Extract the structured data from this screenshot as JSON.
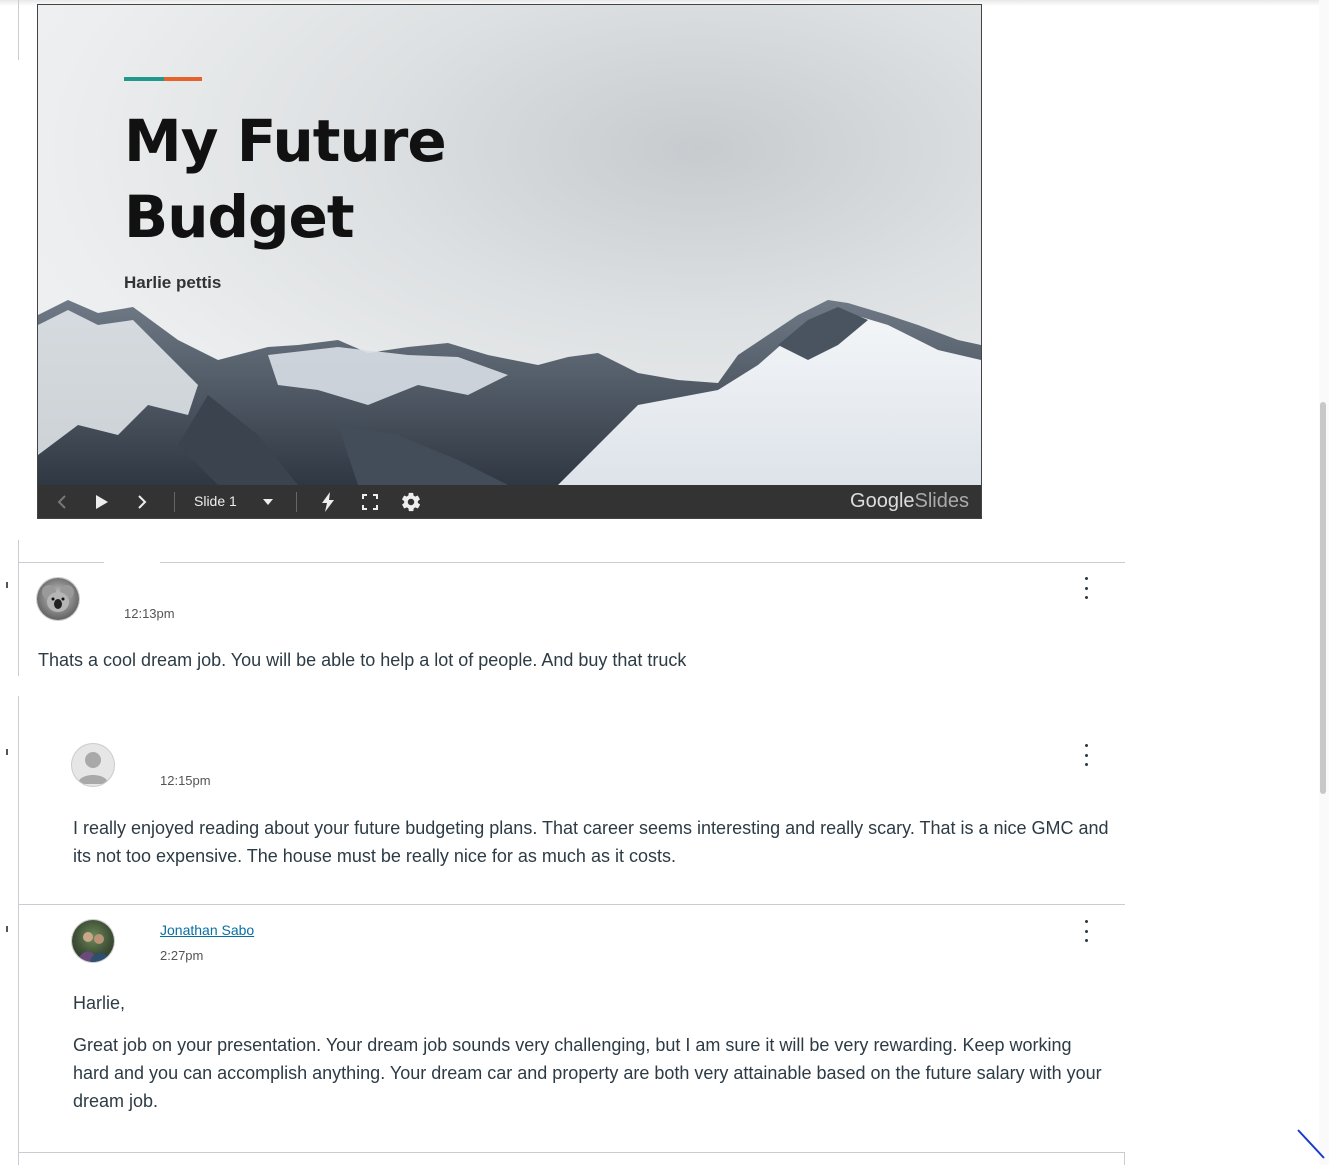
{
  "slide": {
    "title": "My Future\nBudget",
    "author": "Harlie pettis",
    "slide_indicator": "Slide 1",
    "brand_bold": "Google",
    "brand_light": "Slides",
    "accent_colors": [
      "#1f9a8a",
      "#e5632a"
    ]
  },
  "replies": [
    {
      "author": "",
      "time": "12:13pm",
      "avatar": "koala-photo",
      "paragraphs": [
        "Thats a cool dream job. You will be able to help a lot of people. And buy that truck"
      ]
    },
    {
      "author": "",
      "time": "12:15pm",
      "avatar": "default-person-icon",
      "paragraphs": [
        "I really enjoyed reading about your future budgeting plans. That career seems interesting and really scary. That is a nice GMC and its not too expensive. The house must be really nice for as much as it costs."
      ]
    },
    {
      "author": "Jonathan Sabo",
      "time": "2:27pm",
      "avatar": "user-photo",
      "paragraphs": [
        "Harlie,",
        "Great job on your presentation.  Your dream job sounds very challenging, but I am sure it will be very rewarding.  Keep working hard and you can accomplish anything.  Your dream car and property are both very attainable based on the future salary with your dream job."
      ]
    }
  ],
  "colors": {
    "link": "#0770a3",
    "text": "#2d3b45",
    "divider": "#c7cdd1",
    "controls_bg": "#333333"
  }
}
